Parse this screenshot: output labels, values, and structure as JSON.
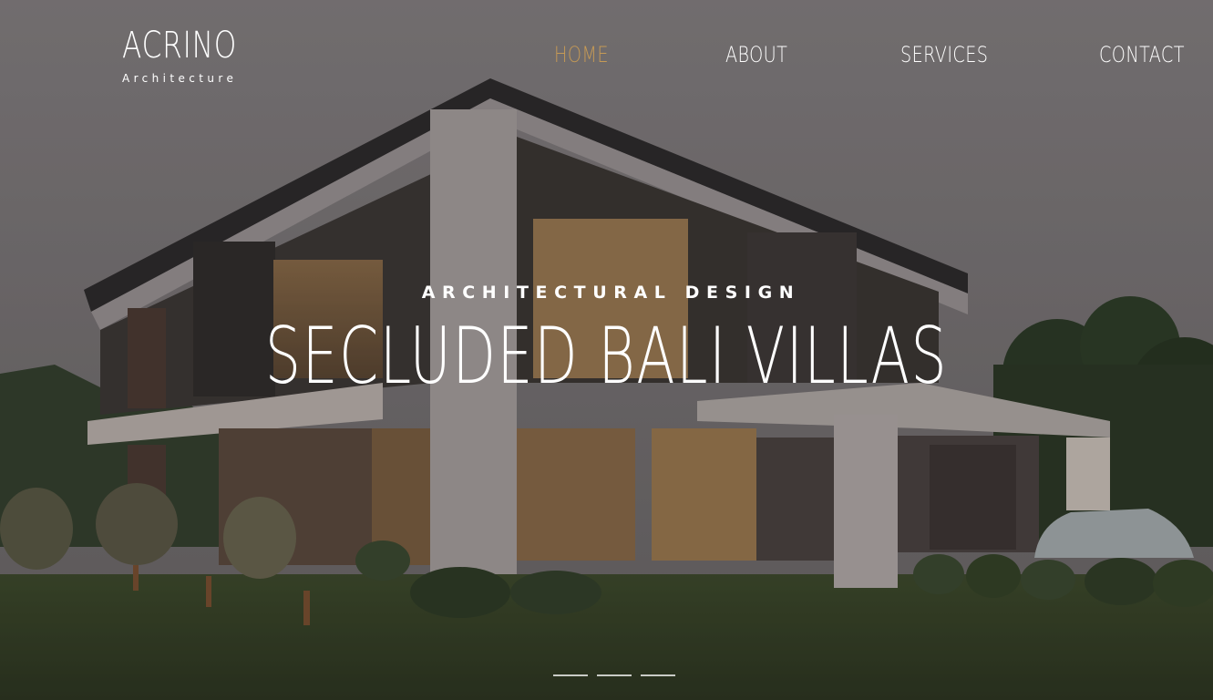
{
  "logo": {
    "name": "ACRINO",
    "tagline": "Architecture"
  },
  "nav": [
    {
      "label": "HOME",
      "active": true
    },
    {
      "label": "ABOUT",
      "active": false
    },
    {
      "label": "SERVICES",
      "active": false
    },
    {
      "label": "CONTACT",
      "active": false
    }
  ],
  "hero": {
    "kicker": "ARCHITECTURAL DESIGN",
    "title": "SECLUDED BALI VILLAS",
    "slides": 3,
    "current_slide": 1
  },
  "colors": {
    "accent": "#c69a55",
    "text": "#ffffff"
  }
}
